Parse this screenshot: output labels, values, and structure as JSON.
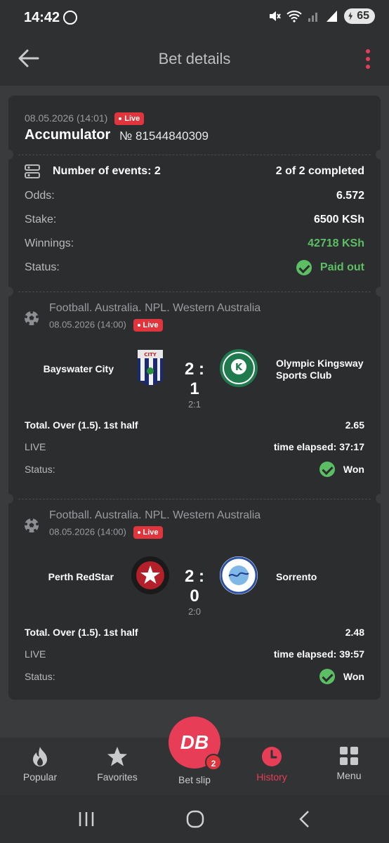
{
  "status_bar": {
    "time": "14:42",
    "battery": "65"
  },
  "header": {
    "title": "Bet details"
  },
  "bet": {
    "date": "08.05.2026 (14:01)",
    "live_label": "Live",
    "type": "Accumulator",
    "number": "№ 81544840309",
    "events_label": "Number of events: 2",
    "completed": "2 of 2 completed",
    "odds_label": "Odds:",
    "odds": "6.572",
    "stake_label": "Stake:",
    "stake": "6500 KSh",
    "winnings_label": "Winnings:",
    "winnings": "42718 KSh",
    "status_label": "Status:",
    "status": "Paid out"
  },
  "events": [
    {
      "league": "Football. Australia. NPL. Western Australia",
      "date": "08.05.2026 (14:00)",
      "live_label": "Live",
      "home": "Bayswater City",
      "away_line1": "Olympic Kingsway",
      "away_line2": "Sports Club",
      "score": "2 : 1",
      "half_score": "2:1",
      "market": "Total. Over (1.5). 1st half",
      "odds": "2.65",
      "live_text": "LIVE",
      "elapsed": "time elapsed: 37:17",
      "status_label": "Status:",
      "result": "Won"
    },
    {
      "league": "Football. Australia. NPL. Western Australia",
      "date": "08.05.2026 (14:00)",
      "live_label": "Live",
      "home": "Perth RedStar",
      "away_line1": "Sorrento",
      "away_line2": "",
      "score": "2 : 0",
      "half_score": "2:0",
      "market": "Total. Over (1.5). 1st half",
      "odds": "2.48",
      "live_text": "LIVE",
      "elapsed": "time elapsed: 39:57",
      "status_label": "Status:",
      "result": "Won"
    }
  ],
  "nav": {
    "popular": "Popular",
    "favorites": "Favorites",
    "betslip": "Bet slip",
    "betslip_badge": "2",
    "fab_logo": "DB",
    "history": "History",
    "menu": "Menu"
  },
  "colors": {
    "accent": "#e83d57",
    "success": "#5cbf63",
    "live": "#e0353d"
  }
}
